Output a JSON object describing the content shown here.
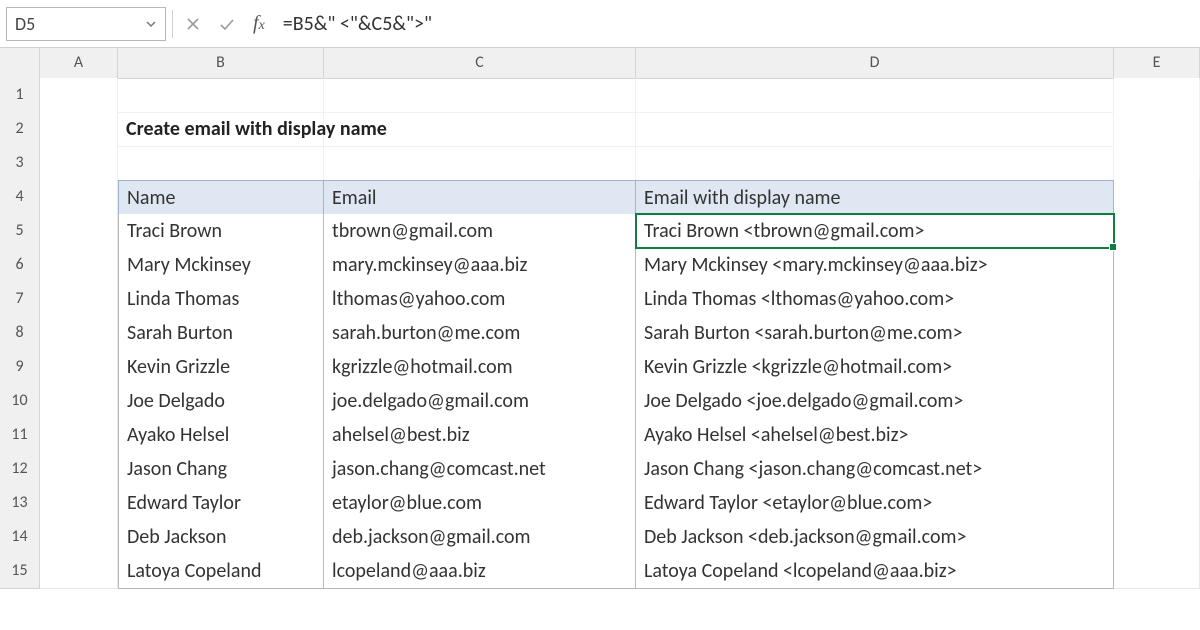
{
  "namebox": {
    "value": "D5"
  },
  "formula": {
    "value": "=B5&\" <\"&C5&\">\""
  },
  "columns": [
    "A",
    "B",
    "C",
    "D",
    "E"
  ],
  "rowNumbers": [
    1,
    2,
    3,
    4,
    5,
    6,
    7,
    8,
    9,
    10,
    11,
    12,
    13,
    14,
    15
  ],
  "title": "Create email with display name",
  "headers": {
    "name": "Name",
    "email": "Email",
    "display": "Email with display name"
  },
  "data": [
    {
      "name": "Traci Brown",
      "email": "tbrown@gmail.com",
      "display": "Traci Brown <tbrown@gmail.com>"
    },
    {
      "name": "Mary Mckinsey",
      "email": "mary.mckinsey@aaa.biz",
      "display": "Mary Mckinsey <mary.mckinsey@aaa.biz>"
    },
    {
      "name": "Linda Thomas",
      "email": "lthomas@yahoo.com",
      "display": "Linda Thomas <lthomas@yahoo.com>"
    },
    {
      "name": "Sarah Burton",
      "email": "sarah.burton@me.com",
      "display": "Sarah Burton <sarah.burton@me.com>"
    },
    {
      "name": "Kevin Grizzle",
      "email": "kgrizzle@hotmail.com",
      "display": "Kevin Grizzle <kgrizzle@hotmail.com>"
    },
    {
      "name": "Joe Delgado",
      "email": "joe.delgado@gmail.com",
      "display": "Joe Delgado <joe.delgado@gmail.com>"
    },
    {
      "name": "Ayako Helsel",
      "email": "ahelsel@best.biz",
      "display": "Ayako Helsel <ahelsel@best.biz>"
    },
    {
      "name": "Jason Chang",
      "email": "jason.chang@comcast.net",
      "display": "Jason Chang <jason.chang@comcast.net>"
    },
    {
      "name": "Edward Taylor",
      "email": "etaylor@blue.com",
      "display": "Edward Taylor <etaylor@blue.com>"
    },
    {
      "name": "Deb Jackson",
      "email": "deb.jackson@gmail.com",
      "display": "Deb Jackson <deb.jackson@gmail.com>"
    },
    {
      "name": "Latoya Copeland",
      "email": "lcopeland@aaa.biz",
      "display": "Latoya Copeland <lcopeland@aaa.biz>"
    }
  ],
  "selection": {
    "cell": "D5"
  }
}
